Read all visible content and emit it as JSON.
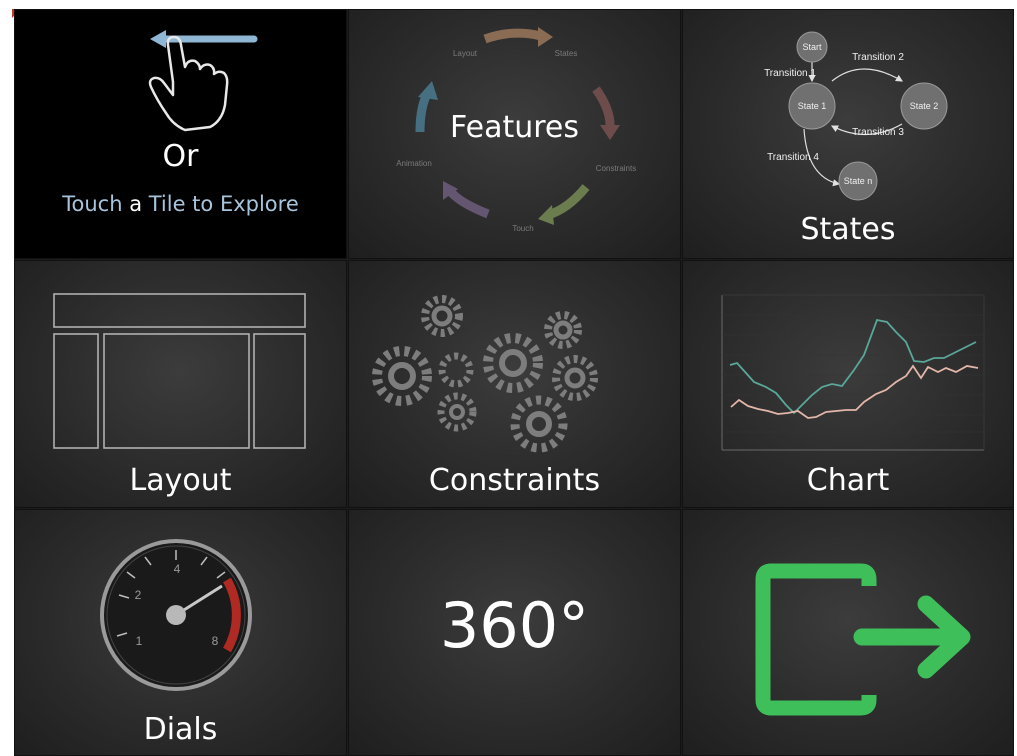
{
  "tiles": {
    "explore": {
      "title": "Or",
      "subtitle_parts": [
        "Touch ",
        "a",
        " Tile to Explore"
      ]
    },
    "features": {
      "title": "Features",
      "cycle_labels": [
        "Layout",
        "States",
        "Constraints",
        "Touch",
        "Animation"
      ],
      "arrow_colors": [
        "#b38a6d",
        "#8f5d5d",
        "#8ba065",
        "#857090",
        "#5b8fa6"
      ]
    },
    "states": {
      "title": "States",
      "nodes": [
        "Start",
        "State 1",
        "State 2",
        "State n"
      ],
      "transitions": [
        "Transition 1",
        "Transition 2",
        "Transition 3",
        "Transition 4"
      ]
    },
    "layout": {
      "title": "Layout"
    },
    "constraints": {
      "title": "Constraints"
    },
    "chart": {
      "title": "Chart"
    },
    "dials": {
      "title": "Dials",
      "gauge_ticks": [
        "1",
        "2",
        "4",
        "8"
      ]
    },
    "rotation": {
      "title": "360°"
    },
    "exit": {
      "icon": "exit-icon",
      "color": "#3fbf5a"
    }
  }
}
